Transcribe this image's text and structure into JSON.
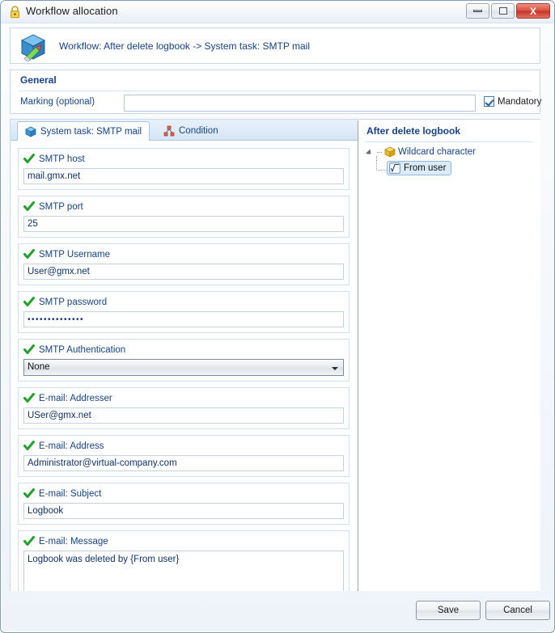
{
  "window": {
    "title": "Workflow allocation",
    "lock_icon": "lock-icon",
    "controls": {
      "minimize": "minimize-icon",
      "maximize": "maximize-icon",
      "close": "close-icon",
      "close_glyph": "X"
    }
  },
  "header": {
    "icon": "workflow-cube-icon",
    "title": "Workflow: After delete logbook -> System task: SMTP mail"
  },
  "general": {
    "section_title": "General",
    "marking_label": "Marking (optional)",
    "marking_value": "",
    "marking_placeholder": "",
    "mandatory_label": "Mandatory",
    "mandatory_checked": true
  },
  "tabs": [
    {
      "id": "system-task-smtp-mail",
      "label": "System task: SMTP mail",
      "icon": "blue-cube-icon",
      "active": true
    },
    {
      "id": "condition",
      "label": "Condition",
      "icon": "condition-nodes-icon",
      "active": false
    }
  ],
  "fields": [
    {
      "id": "smtp-host",
      "label": "SMTP host",
      "value": "mail.gmx.net",
      "type": "text",
      "status_icon": "green-check-icon"
    },
    {
      "id": "smtp-port",
      "label": "SMTP port",
      "value": "25",
      "type": "text",
      "status_icon": "green-check-icon"
    },
    {
      "id": "smtp-username",
      "label": "SMTP Username",
      "value": "User@gmx.net",
      "type": "text",
      "status_icon": "green-check-icon"
    },
    {
      "id": "smtp-password",
      "label": "SMTP password",
      "value": "••••••••••••••",
      "type": "password",
      "status_icon": "green-check-icon"
    },
    {
      "id": "smtp-authentication",
      "label": "SMTP Authentication",
      "value": "None",
      "type": "select",
      "status_icon": "green-check-icon",
      "options": [
        "None"
      ]
    },
    {
      "id": "email-addresser",
      "label": "E-mail: Addresser",
      "value": "USer@gmx.net",
      "type": "text",
      "status_icon": "green-check-icon"
    },
    {
      "id": "email-address",
      "label": "E-mail: Address",
      "value": "Administrator@virtual-company.com",
      "type": "text",
      "status_icon": "green-check-icon"
    },
    {
      "id": "email-subject",
      "label": "E-mail: Subject",
      "value": "Logbook",
      "type": "text",
      "status_icon": "green-check-icon"
    },
    {
      "id": "email-message",
      "label": "E-mail: Message",
      "value": "Logbook was deleted by {From user}",
      "type": "textarea",
      "status_icon": "green-check-icon"
    }
  ],
  "tree": {
    "title": "After delete logbook",
    "root": {
      "label": "Wildcard character",
      "icon": "yellow-cube-icon",
      "expanded": true
    },
    "child": {
      "label": "From user",
      "icon": "formula-icon",
      "selected": true
    }
  },
  "footer": {
    "save_label": "Save",
    "cancel_label": "Cancel"
  },
  "colors": {
    "accent_blue": "#15428b",
    "check_green": "#22a12c",
    "close_red": "#c63325",
    "panel_border": "#c8d9ea",
    "selection_blue": "#dbebfb"
  }
}
